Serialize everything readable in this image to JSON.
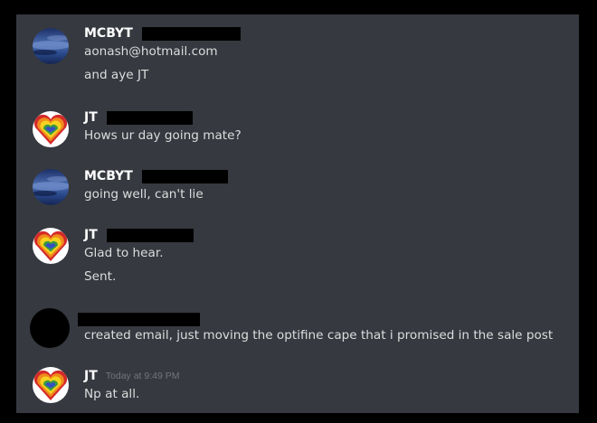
{
  "messages": [
    {
      "username": "MCBYT",
      "avatar": "night-sky-avatar",
      "lines": [
        "aonash@hotmail.com",
        "and aye JT"
      ]
    },
    {
      "username": "JT",
      "avatar": "rainbow-heart-avatar",
      "lines": [
        "Hows ur day going mate?"
      ]
    },
    {
      "username": "MCBYT",
      "avatar": "night-sky-avatar",
      "lines": [
        "going well, can't lie"
      ]
    },
    {
      "username": "JT",
      "avatar": "rainbow-heart-avatar",
      "lines": [
        "Glad to hear.",
        "Sent."
      ]
    },
    {
      "username": "",
      "avatar": "black-circle-avatar",
      "lines": [
        "created email, just moving the optifine cape that i promised in the sale post"
      ]
    },
    {
      "username": "JT",
      "avatar": "rainbow-heart-avatar",
      "timestamp": "Today at 9:49 PM",
      "lines": [
        "Np at all."
      ]
    }
  ],
  "colors": {
    "background": "#36393f",
    "username": "#ffffff",
    "message_text": "#dcddde",
    "timestamp": "#72767d",
    "redaction": "#000000"
  }
}
